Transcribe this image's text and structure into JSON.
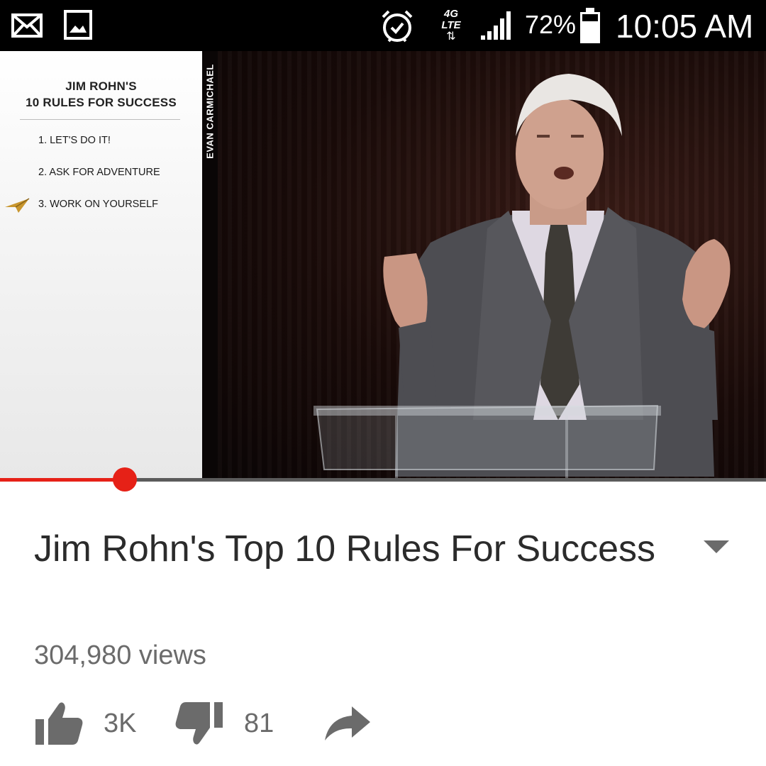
{
  "status_bar": {
    "icons": [
      "mail-icon",
      "image-icon",
      "alarm-icon",
      "network-4g-lte-icon",
      "signal-icon",
      "battery-icon"
    ],
    "network_label": "4G LTE",
    "battery_percent": "72%",
    "time": "10:05 AM"
  },
  "video": {
    "panel": {
      "title_line1": "JIM ROHN'S",
      "title_line2": "10 RULES FOR SUCCESS",
      "rules": [
        "1. LET'S DO IT!",
        "2. ASK FOR ADVENTURE",
        "3. WORK ON YOURSELF"
      ],
      "current_rule_index": 2
    },
    "credit": "EVAN CARMICHAEL",
    "progress_fraction": 0.163
  },
  "details": {
    "title": "Jim Rohn's Top 10 Rules For Success",
    "views": "304,980 views",
    "likes": "3K",
    "dislikes": "81"
  },
  "colors": {
    "accent": "#e62117",
    "text_primary": "#2b2b2b",
    "text_secondary": "#6b6b6b",
    "arrow_gold": "#c8962e"
  }
}
